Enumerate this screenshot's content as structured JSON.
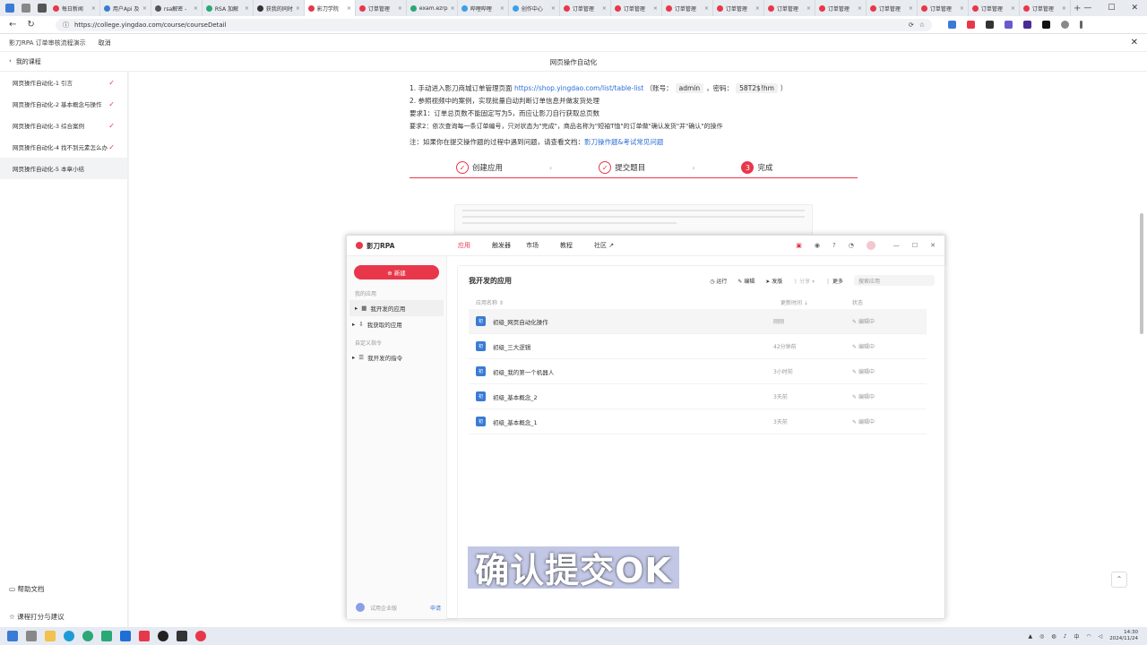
{
  "browser": {
    "tabs": [
      {
        "label": "每日新闻",
        "color": "#e8374b"
      },
      {
        "label": "用户Api 及",
        "color": "#3a7bd5"
      },
      {
        "label": "rsa解密 - ",
        "color": "#555"
      },
      {
        "label": "RSA 加解",
        "color": "#2aa876"
      },
      {
        "label": "获我的同时",
        "color": "#333"
      },
      {
        "label": "影刀学院",
        "color": "#e8374b",
        "active": true
      },
      {
        "label": "订单管理",
        "color": "#e8374b"
      },
      {
        "label": "exam.ezrp",
        "color": "#2aa876"
      },
      {
        "label": "哔哩哔哩",
        "color": "#3aa0e8"
      },
      {
        "label": "创作中心",
        "color": "#3aa0e8"
      },
      {
        "label": "订单管理",
        "color": "#e8374b"
      },
      {
        "label": "订单管理",
        "color": "#e8374b"
      },
      {
        "label": "订单管理",
        "color": "#e8374b"
      },
      {
        "label": "订单管理",
        "color": "#e8374b"
      },
      {
        "label": "订单管理",
        "color": "#e8374b"
      },
      {
        "label": "订单管理",
        "color": "#e8374b"
      },
      {
        "label": "订单管理",
        "color": "#e8374b"
      },
      {
        "label": "订单管理",
        "color": "#e8374b"
      },
      {
        "label": "订单管理",
        "color": "#e8374b"
      },
      {
        "label": "订单管理",
        "color": "#e8374b"
      }
    ],
    "tab_close": "×",
    "new_tab": "+",
    "url": "https://college.yingdao.com/course/courseDetail"
  },
  "header": {
    "title": "影刀RPA 订单审核流程演示",
    "cancel": "取消",
    "close": "✕"
  },
  "course": {
    "back_label": "我的课程",
    "page_title": "网页操作自动化",
    "items": [
      {
        "label": "网页操作自动化-1 引言",
        "done": true
      },
      {
        "label": "网页操作自动化-2 基本概念与操作",
        "done": true
      },
      {
        "label": "网页操作自动化-3 综合案例",
        "done": true
      },
      {
        "label": "网页操作自动化-4 找不到元素怎么办",
        "done": true
      },
      {
        "label": "网页操作自动化-5 本章小结",
        "done": false
      }
    ],
    "help": "帮助文档",
    "feedback": "课程打分与建议"
  },
  "instructions": {
    "line1_pre": "1. 手动进入影刀商城订单管理页面",
    "line1_link": "https://shop.yingdao.com/list/table-list",
    "line1_acct": "（账号：",
    "line1_user": "admin",
    "line1_pwd": "，密码：",
    "line1_pass": "58T2$!hm",
    "line1_end": "）",
    "line2": "2. 参照视频中的案例，实现批量自动判断订单信息并做发货处理",
    "line3": "要求1：订单总页数不能固定写为5，而应让影刀自行获取总页数",
    "line4": "要求2：依次查询每一条订单编号，只对状态为\"完成\"，商品名称为\"短袖T恤\"的订单做\"确认发货\"并\"确认\"的操作",
    "note_pre": "注：如果你在提交操作题的过程中遇到问题，请查看文档：",
    "note_link": "影刀操作题&考试常见问题"
  },
  "steps": [
    {
      "label": "创建应用",
      "mark": "✓"
    },
    {
      "label": "提交题目",
      "mark": "✓"
    },
    {
      "label": "完成",
      "mark": "3"
    }
  ],
  "rpa": {
    "brand": "影刀RPA",
    "nav": [
      "应用",
      "触发器",
      "市场",
      "教程",
      "社区 ↗"
    ],
    "new_button": "⊕ 新建",
    "section_my": "我的应用",
    "item_dev": "我开发的应用",
    "item_got": "我获取的应用",
    "section_cmd": "自定义指令",
    "item_cmd": "我开发的指令",
    "panel_title": "我开发的应用",
    "actions": [
      "◷ 运行",
      "✎ 编辑",
      "➤ 发版",
      "⇪ 分享 ▾",
      "⋮ 更多"
    ],
    "search_placeholder": "搜索应用",
    "col_name": "应用名称 ⇕",
    "col_time": "更新时间 ⇣",
    "col_status": "状态",
    "apps": [
      {
        "name": "初级_网页自动化操作",
        "time": "刚刚",
        "status": "编辑中"
      },
      {
        "name": "初级_三大逻辑",
        "time": "42分钟前",
        "status": "编辑中"
      },
      {
        "name": "初级_我的第一个机器人",
        "time": "3小时前",
        "status": "编辑中"
      },
      {
        "name": "初级_基本概念_2",
        "time": "3天前",
        "status": "编辑中"
      },
      {
        "name": "初级_基本概念_1",
        "time": "3天前",
        "status": "编辑中"
      }
    ],
    "app_icon": "初",
    "trial": "试用企业版",
    "apply": "申请"
  },
  "caption": "确认提交OK",
  "taskbar": {
    "lang": "中",
    "time": "14:30",
    "date": "2024/11/24"
  }
}
